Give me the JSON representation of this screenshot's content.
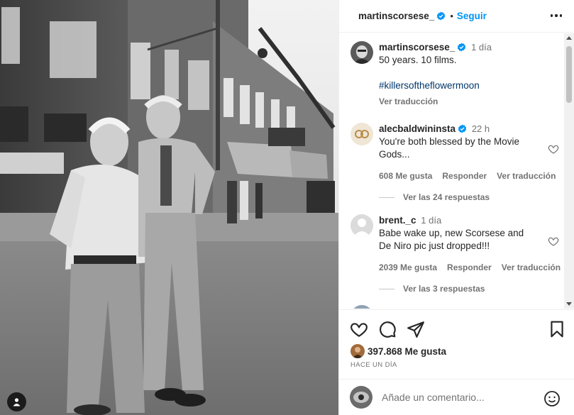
{
  "post": {
    "author": "martinscorsese_",
    "follow_label": "Seguir",
    "caption_time": "1 día",
    "caption_line1": "50 years. 10 films.",
    "caption_hashtag": "#killersoftheflowermoon",
    "see_translation": "Ver traducción"
  },
  "comments": [
    {
      "user": "alecbaldwininsta",
      "time": "22 h",
      "text": "You're both blessed by the Movie Gods...",
      "likes": "608 Me gusta",
      "reply": "Responder",
      "translate": "Ver traducción",
      "replies": "Ver las 24 respuestas"
    },
    {
      "user": "brent._c",
      "time": "1 día",
      "text": "Babe wake up, new Scorsese and De Niro pic just dropped!!!",
      "likes": "2039 Me gusta",
      "reply": "Responder",
      "translate": "Ver traducción",
      "replies": "Ver las 3 respuestas"
    }
  ],
  "actions": {
    "likes": "397.868 Me gusta",
    "posted": "HACE UN DÍA"
  },
  "composer": {
    "placeholder": "Añade un comentario..."
  },
  "icons": {
    "verified": "verified-badge-icon",
    "like": "heart-icon",
    "comment": "comment-bubble-icon",
    "share": "paper-plane-icon",
    "save": "bookmark-icon",
    "emoji": "smiley-icon",
    "more": "more-options-icon",
    "tag": "user-tag-icon"
  },
  "colors": {
    "link_blue": "#0095f6",
    "hashtag": "#00376b",
    "muted": "#737373"
  }
}
